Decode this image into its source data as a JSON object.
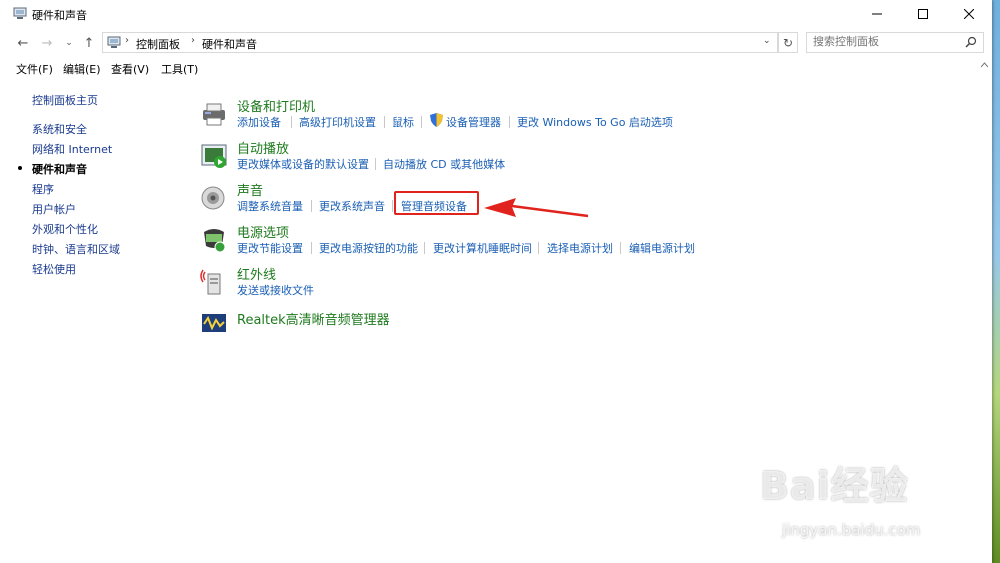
{
  "window": {
    "title": "硬件和声音"
  },
  "address": {
    "crumbs": [
      "控制面板",
      "硬件和声音"
    ]
  },
  "search": {
    "placeholder": "搜索控制面板"
  },
  "menu": {
    "items": [
      "文件(F)",
      "编辑(E)",
      "查看(V)",
      "工具(T)"
    ]
  },
  "sidebar": {
    "items": [
      {
        "label": "控制面板主页"
      },
      {
        "label": "系统和安全"
      },
      {
        "label": "网络和 Internet"
      },
      {
        "label": "硬件和声音",
        "active": true
      },
      {
        "label": "程序"
      },
      {
        "label": "用户帐户"
      },
      {
        "label": "外观和个性化"
      },
      {
        "label": "时钟、语言和区域"
      },
      {
        "label": "轻松使用"
      }
    ]
  },
  "categories": [
    {
      "title": "设备和打印机",
      "icon": "printer-icon",
      "links": [
        "添加设备",
        "高级打印机设置",
        "鼠标",
        "设备管理器",
        "更改 Windows To Go 启动选项"
      ]
    },
    {
      "title": "自动播放",
      "icon": "autoplay-icon",
      "links": [
        "更改媒体或设备的默认设置",
        "自动播放 CD 或其他媒体"
      ]
    },
    {
      "title": "声音",
      "icon": "speaker-icon",
      "links": [
        "调整系统音量",
        "更改系统声音",
        "管理音频设备"
      ]
    },
    {
      "title": "电源选项",
      "icon": "power-icon",
      "links": [
        "更改节能设置",
        "更改电源按钮的功能",
        "更改计算机睡眠时间",
        "选择电源计划",
        "编辑电源计划"
      ]
    },
    {
      "title": "红外线",
      "icon": "infrared-icon",
      "links": [
        "发送或接收文件"
      ]
    },
    {
      "title": "Realtek高清晰音频管理器",
      "icon": "realtek-icon",
      "links": []
    }
  ],
  "annotation": {
    "highlight_color": "#e0231c"
  },
  "watermark": {
    "text": "Bai经验",
    "sub": "jingyan.baidu.com"
  },
  "colors": {
    "link": "#1a5fb4",
    "category": "#1e7a1e",
    "sidebar": "#1a3a8f"
  }
}
